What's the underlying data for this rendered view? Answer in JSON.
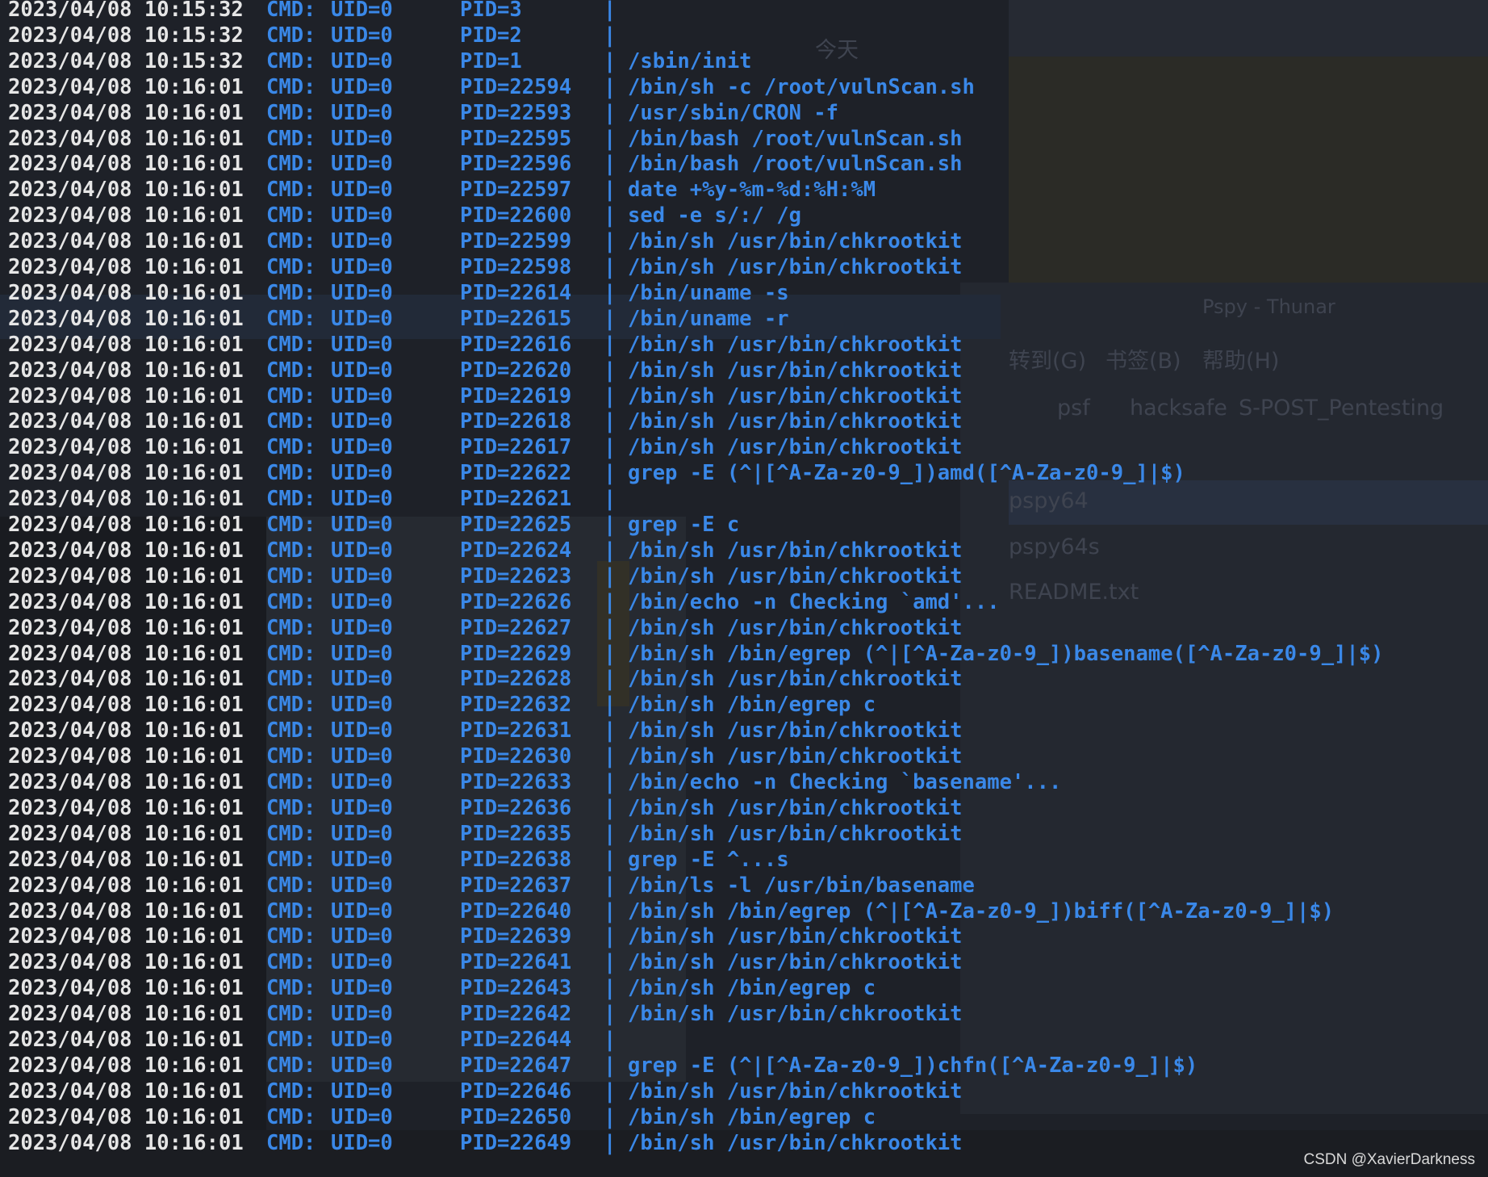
{
  "background": {
    "color": "#1e2128",
    "ghost_texts": [
      "Pspy - Thunar",
      "转到(G)",
      "书签(B)",
      "帮助(H)",
      "psf",
      "hacksafe",
      "S-POST_Pentesting",
      "pspy64",
      "pspy64s",
      "README.txt",
      "今天"
    ]
  },
  "terminal": {
    "colors": {
      "timestamp": "#e6e6e6",
      "accent": "#3a88e8"
    },
    "rows": [
      {
        "ts": "2023/04/08 10:15:32",
        "cmd": "CMD:",
        "uid": "UID=0",
        "pid": "PID=3",
        "sep": "|",
        "text": ""
      },
      {
        "ts": "2023/04/08 10:15:32",
        "cmd": "CMD:",
        "uid": "UID=0",
        "pid": "PID=2",
        "sep": "|",
        "text": ""
      },
      {
        "ts": "2023/04/08 10:15:32",
        "cmd": "CMD:",
        "uid": "UID=0",
        "pid": "PID=1",
        "sep": "|",
        "text": "/sbin/init"
      },
      {
        "ts": "2023/04/08 10:16:01",
        "cmd": "CMD:",
        "uid": "UID=0",
        "pid": "PID=22594",
        "sep": "|",
        "text": "/bin/sh -c /root/vulnScan.sh"
      },
      {
        "ts": "2023/04/08 10:16:01",
        "cmd": "CMD:",
        "uid": "UID=0",
        "pid": "PID=22593",
        "sep": "|",
        "text": "/usr/sbin/CRON -f"
      },
      {
        "ts": "2023/04/08 10:16:01",
        "cmd": "CMD:",
        "uid": "UID=0",
        "pid": "PID=22595",
        "sep": "|",
        "text": "/bin/bash /root/vulnScan.sh"
      },
      {
        "ts": "2023/04/08 10:16:01",
        "cmd": "CMD:",
        "uid": "UID=0",
        "pid": "PID=22596",
        "sep": "|",
        "text": "/bin/bash /root/vulnScan.sh"
      },
      {
        "ts": "2023/04/08 10:16:01",
        "cmd": "CMD:",
        "uid": "UID=0",
        "pid": "PID=22597",
        "sep": "|",
        "text": "date +%y-%m-%d:%H:%M"
      },
      {
        "ts": "2023/04/08 10:16:01",
        "cmd": "CMD:",
        "uid": "UID=0",
        "pid": "PID=22600",
        "sep": "|",
        "text": "sed -e s/:/ /g"
      },
      {
        "ts": "2023/04/08 10:16:01",
        "cmd": "CMD:",
        "uid": "UID=0",
        "pid": "PID=22599",
        "sep": "|",
        "text": "/bin/sh /usr/bin/chkrootkit"
      },
      {
        "ts": "2023/04/08 10:16:01",
        "cmd": "CMD:",
        "uid": "UID=0",
        "pid": "PID=22598",
        "sep": "|",
        "text": "/bin/sh /usr/bin/chkrootkit"
      },
      {
        "ts": "2023/04/08 10:16:01",
        "cmd": "CMD:",
        "uid": "UID=0",
        "pid": "PID=22614",
        "sep": "|",
        "text": "/bin/uname -s"
      },
      {
        "ts": "2023/04/08 10:16:01",
        "cmd": "CMD:",
        "uid": "UID=0",
        "pid": "PID=22615",
        "sep": "|",
        "text": "/bin/uname -r"
      },
      {
        "ts": "2023/04/08 10:16:01",
        "cmd": "CMD:",
        "uid": "UID=0",
        "pid": "PID=22616",
        "sep": "|",
        "text": "/bin/sh /usr/bin/chkrootkit"
      },
      {
        "ts": "2023/04/08 10:16:01",
        "cmd": "CMD:",
        "uid": "UID=0",
        "pid": "PID=22620",
        "sep": "|",
        "text": "/bin/sh /usr/bin/chkrootkit"
      },
      {
        "ts": "2023/04/08 10:16:01",
        "cmd": "CMD:",
        "uid": "UID=0",
        "pid": "PID=22619",
        "sep": "|",
        "text": "/bin/sh /usr/bin/chkrootkit"
      },
      {
        "ts": "2023/04/08 10:16:01",
        "cmd": "CMD:",
        "uid": "UID=0",
        "pid": "PID=22618",
        "sep": "|",
        "text": "/bin/sh /usr/bin/chkrootkit"
      },
      {
        "ts": "2023/04/08 10:16:01",
        "cmd": "CMD:",
        "uid": "UID=0",
        "pid": "PID=22617",
        "sep": "|",
        "text": "/bin/sh /usr/bin/chkrootkit"
      },
      {
        "ts": "2023/04/08 10:16:01",
        "cmd": "CMD:",
        "uid": "UID=0",
        "pid": "PID=22622",
        "sep": "|",
        "text": "grep -E (^|[^A-Za-z0-9_])amd([^A-Za-z0-9_]|$)"
      },
      {
        "ts": "2023/04/08 10:16:01",
        "cmd": "CMD:",
        "uid": "UID=0",
        "pid": "PID=22621",
        "sep": "|",
        "text": ""
      },
      {
        "ts": "2023/04/08 10:16:01",
        "cmd": "CMD:",
        "uid": "UID=0",
        "pid": "PID=22625",
        "sep": "|",
        "text": "grep -E c"
      },
      {
        "ts": "2023/04/08 10:16:01",
        "cmd": "CMD:",
        "uid": "UID=0",
        "pid": "PID=22624",
        "sep": "|",
        "text": "/bin/sh /usr/bin/chkrootkit"
      },
      {
        "ts": "2023/04/08 10:16:01",
        "cmd": "CMD:",
        "uid": "UID=0",
        "pid": "PID=22623",
        "sep": "|",
        "text": "/bin/sh /usr/bin/chkrootkit"
      },
      {
        "ts": "2023/04/08 10:16:01",
        "cmd": "CMD:",
        "uid": "UID=0",
        "pid": "PID=22626",
        "sep": "|",
        "text": "/bin/echo -n Checking `amd'..."
      },
      {
        "ts": "2023/04/08 10:16:01",
        "cmd": "CMD:",
        "uid": "UID=0",
        "pid": "PID=22627",
        "sep": "|",
        "text": "/bin/sh /usr/bin/chkrootkit"
      },
      {
        "ts": "2023/04/08 10:16:01",
        "cmd": "CMD:",
        "uid": "UID=0",
        "pid": "PID=22629",
        "sep": "|",
        "text": "/bin/sh /bin/egrep (^|[^A-Za-z0-9_])basename([^A-Za-z0-9_]|$)"
      },
      {
        "ts": "2023/04/08 10:16:01",
        "cmd": "CMD:",
        "uid": "UID=0",
        "pid": "PID=22628",
        "sep": "|",
        "text": "/bin/sh /usr/bin/chkrootkit"
      },
      {
        "ts": "2023/04/08 10:16:01",
        "cmd": "CMD:",
        "uid": "UID=0",
        "pid": "PID=22632",
        "sep": "|",
        "text": "/bin/sh /bin/egrep c"
      },
      {
        "ts": "2023/04/08 10:16:01",
        "cmd": "CMD:",
        "uid": "UID=0",
        "pid": "PID=22631",
        "sep": "|",
        "text": "/bin/sh /usr/bin/chkrootkit"
      },
      {
        "ts": "2023/04/08 10:16:01",
        "cmd": "CMD:",
        "uid": "UID=0",
        "pid": "PID=22630",
        "sep": "|",
        "text": "/bin/sh /usr/bin/chkrootkit"
      },
      {
        "ts": "2023/04/08 10:16:01",
        "cmd": "CMD:",
        "uid": "UID=0",
        "pid": "PID=22633",
        "sep": "|",
        "text": "/bin/echo -n Checking `basename'..."
      },
      {
        "ts": "2023/04/08 10:16:01",
        "cmd": "CMD:",
        "uid": "UID=0",
        "pid": "PID=22636",
        "sep": "|",
        "text": "/bin/sh /usr/bin/chkrootkit"
      },
      {
        "ts": "2023/04/08 10:16:01",
        "cmd": "CMD:",
        "uid": "UID=0",
        "pid": "PID=22635",
        "sep": "|",
        "text": "/bin/sh /usr/bin/chkrootkit"
      },
      {
        "ts": "2023/04/08 10:16:01",
        "cmd": "CMD:",
        "uid": "UID=0",
        "pid": "PID=22638",
        "sep": "|",
        "text": "grep -E ^...s"
      },
      {
        "ts": "2023/04/08 10:16:01",
        "cmd": "CMD:",
        "uid": "UID=0",
        "pid": "PID=22637",
        "sep": "|",
        "text": "/bin/ls -l /usr/bin/basename"
      },
      {
        "ts": "2023/04/08 10:16:01",
        "cmd": "CMD:",
        "uid": "UID=0",
        "pid": "PID=22640",
        "sep": "|",
        "text": "/bin/sh /bin/egrep (^|[^A-Za-z0-9_])biff([^A-Za-z0-9_]|$)"
      },
      {
        "ts": "2023/04/08 10:16:01",
        "cmd": "CMD:",
        "uid": "UID=0",
        "pid": "PID=22639",
        "sep": "|",
        "text": "/bin/sh /usr/bin/chkrootkit"
      },
      {
        "ts": "2023/04/08 10:16:01",
        "cmd": "CMD:",
        "uid": "UID=0",
        "pid": "PID=22641",
        "sep": "|",
        "text": "/bin/sh /usr/bin/chkrootkit"
      },
      {
        "ts": "2023/04/08 10:16:01",
        "cmd": "CMD:",
        "uid": "UID=0",
        "pid": "PID=22643",
        "sep": "|",
        "text": "/bin/sh /bin/egrep c"
      },
      {
        "ts": "2023/04/08 10:16:01",
        "cmd": "CMD:",
        "uid": "UID=0",
        "pid": "PID=22642",
        "sep": "|",
        "text": "/bin/sh /usr/bin/chkrootkit"
      },
      {
        "ts": "2023/04/08 10:16:01",
        "cmd": "CMD:",
        "uid": "UID=0",
        "pid": "PID=22644",
        "sep": "|",
        "text": ""
      },
      {
        "ts": "2023/04/08 10:16:01",
        "cmd": "CMD:",
        "uid": "UID=0",
        "pid": "PID=22647",
        "sep": "|",
        "text": "grep -E (^|[^A-Za-z0-9_])chfn([^A-Za-z0-9_]|$)"
      },
      {
        "ts": "2023/04/08 10:16:01",
        "cmd": "CMD:",
        "uid": "UID=0",
        "pid": "PID=22646",
        "sep": "|",
        "text": "/bin/sh /usr/bin/chkrootkit"
      },
      {
        "ts": "2023/04/08 10:16:01",
        "cmd": "CMD:",
        "uid": "UID=0",
        "pid": "PID=22650",
        "sep": "|",
        "text": "/bin/sh /bin/egrep c"
      },
      {
        "ts": "2023/04/08 10:16:01",
        "cmd": "CMD:",
        "uid": "UID=0",
        "pid": "PID=22649",
        "sep": "|",
        "text": "/bin/sh /usr/bin/chkrootkit"
      }
    ]
  },
  "watermark": "CSDN @XavierDarkness"
}
